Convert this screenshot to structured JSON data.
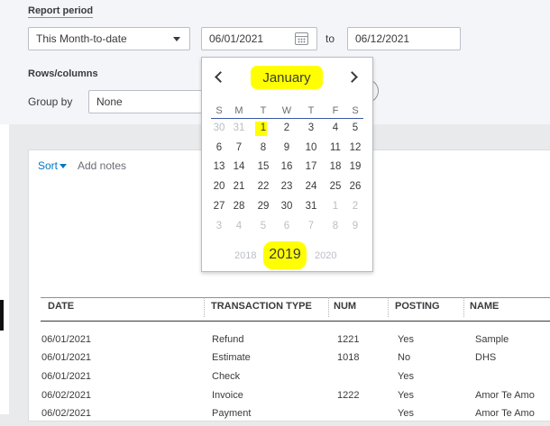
{
  "report_period": {
    "label": "Report period",
    "period_value": "This Month-to-date",
    "from_date": "06/01/2021",
    "to_label": "to",
    "to_date": "06/12/2021"
  },
  "rows_columns": {
    "label": "Rows/columns",
    "group_by_label": "Group by",
    "group_by_value": "None"
  },
  "toolbar": {
    "sort_label": "Sort",
    "add_notes_label": "Add notes"
  },
  "calendar": {
    "month": "January",
    "weekdays": [
      "S",
      "M",
      "T",
      "W",
      "T",
      "F",
      "S"
    ],
    "weeks": [
      [
        "30",
        "31",
        "1",
        "2",
        "3",
        "4",
        "5"
      ],
      [
        "6",
        "7",
        "8",
        "9",
        "10",
        "11",
        "12"
      ],
      [
        "13",
        "14",
        "15",
        "16",
        "17",
        "18",
        "19"
      ],
      [
        "20",
        "21",
        "22",
        "23",
        "24",
        "25",
        "26"
      ],
      [
        "27",
        "28",
        "29",
        "30",
        "31",
        "1",
        "2"
      ],
      [
        "3",
        "4",
        "5",
        "6",
        "7",
        "8",
        "9"
      ]
    ],
    "years": {
      "previous": "2018",
      "current": "2019",
      "next": "2020"
    },
    "highlight_color": "#ffff00"
  },
  "table": {
    "headers": [
      "DATE",
      "TRANSACTION TYPE",
      "NUM",
      "POSTING",
      "NAME"
    ],
    "rows": [
      [
        "06/01/2021",
        "Refund",
        "1221",
        "Yes",
        "Sample"
      ],
      [
        "06/01/2021",
        "Estimate",
        "1018",
        "No",
        "DHS"
      ],
      [
        "06/01/2021",
        "Check",
        "",
        "Yes",
        ""
      ],
      [
        "06/02/2021",
        "Invoice",
        "1222",
        "Yes",
        "Amor Te Amo"
      ],
      [
        "06/02/2021",
        "Payment",
        "",
        "Yes",
        "Amor Te Amo"
      ]
    ]
  },
  "colors": {
    "link": "#0077c5",
    "panel": "#f4f5f8",
    "calendar_rule": "#3b57a3"
  }
}
